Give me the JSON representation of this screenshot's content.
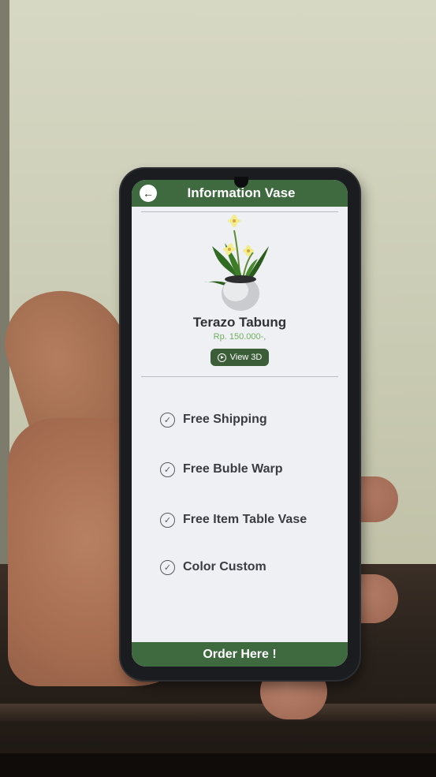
{
  "header": {
    "title": "Information Vase",
    "back_icon": "arrow-left-icon"
  },
  "product": {
    "name": "Terazo Tabung",
    "price": "Rp. 150.000-,",
    "view3d_label": "View 3D",
    "view3d_icon": "play-circle-icon"
  },
  "features": [
    {
      "label": "Free Shipping",
      "icon": "check-circle-icon"
    },
    {
      "label": "Free Buble Warp",
      "icon": "check-circle-icon"
    },
    {
      "label": "Free Item Table Vase",
      "icon": "check-circle-icon"
    },
    {
      "label": "Color Custom",
      "icon": "check-circle-icon"
    }
  ],
  "footer": {
    "order_label": "Order Here !"
  },
  "colors": {
    "bar_green": "#3f6a40",
    "button_green": "#3b5d37",
    "price_green": "#6fb15d",
    "screen_bg": "#eef0f4"
  }
}
